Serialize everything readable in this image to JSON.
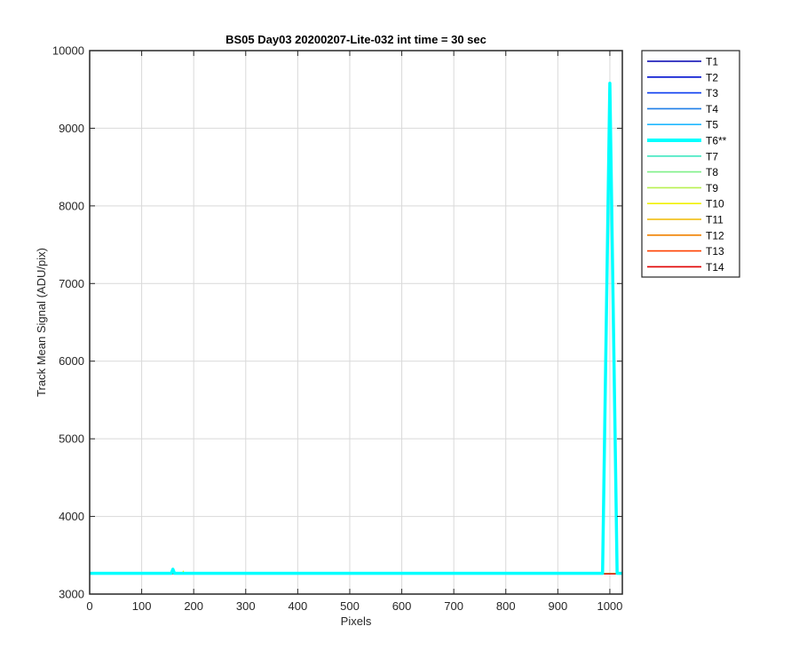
{
  "chart_data": {
    "type": "line",
    "title": "BS05 Day03 20200207-Lite-032 int time = 30 sec",
    "xlabel": "Pixels",
    "ylabel": "Track Mean Signal (ADU/pix)",
    "xlim": [
      0,
      1024
    ],
    "ylim": [
      3000,
      10000
    ],
    "xticks": [
      0,
      100,
      200,
      300,
      400,
      500,
      600,
      700,
      800,
      900,
      1000
    ],
    "yticks": [
      3000,
      4000,
      5000,
      6000,
      7000,
      8000,
      9000,
      10000
    ],
    "grid": true,
    "legend_position": "outside-top-right",
    "series": [
      {
        "name": "T1",
        "color": "#0000b0",
        "base": 3262,
        "highlight": false
      },
      {
        "name": "T2",
        "color": "#0010d0",
        "base": 3262,
        "highlight": false
      },
      {
        "name": "T3",
        "color": "#0a3cf0",
        "base": 3263,
        "highlight": false
      },
      {
        "name": "T4",
        "color": "#1f7fe8",
        "base": 3264,
        "highlight": false
      },
      {
        "name": "T5",
        "color": "#20b8ff",
        "base": 3265,
        "highlight": false
      },
      {
        "name": "T6**",
        "color": "#00ffff",
        "base": 3268,
        "highlight": true,
        "peaks": [
          {
            "x": 160,
            "y": 3320,
            "halfwidth": 3
          },
          {
            "x": 1000,
            "y": 9580,
            "halfwidth": 14
          }
        ]
      },
      {
        "name": "T7",
        "color": "#40e8c0",
        "base": 3266,
        "highlight": false
      },
      {
        "name": "T8",
        "color": "#7ff088",
        "base": 3265,
        "highlight": false
      },
      {
        "name": "T9",
        "color": "#b8f050",
        "base": 3265,
        "highlight": false
      },
      {
        "name": "T10",
        "color": "#f0f000",
        "base": 3264,
        "highlight": false,
        "peaks": [
          {
            "x": 180,
            "y": 3295,
            "halfwidth": 2
          }
        ]
      },
      {
        "name": "T11",
        "color": "#f0b800",
        "base": 3263,
        "highlight": false
      },
      {
        "name": "T12",
        "color": "#f08000",
        "base": 3262,
        "highlight": false
      },
      {
        "name": "T13",
        "color": "#ff4000",
        "base": 3261,
        "highlight": false
      },
      {
        "name": "T14",
        "color": "#e00000",
        "base": 3260,
        "highlight": false
      }
    ]
  }
}
